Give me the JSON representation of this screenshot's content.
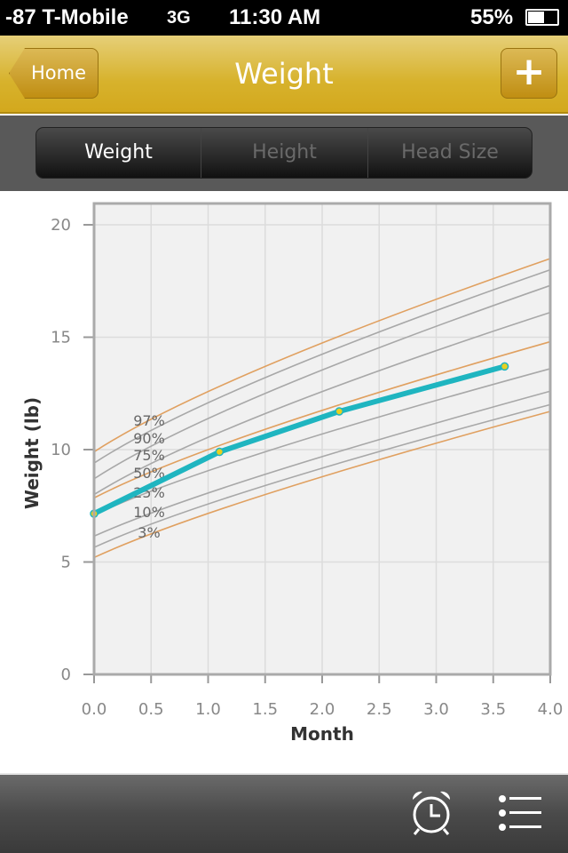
{
  "status_bar": {
    "signal": "-87 T-Mobile",
    "network": "3G",
    "time": "11:30 AM",
    "battery": "55%",
    "battery_level": 0.55
  },
  "nav": {
    "back_label": "Home",
    "title": "Weight",
    "add_label": "+"
  },
  "segments": [
    {
      "label": "Weight",
      "selected": true
    },
    {
      "label": "Height",
      "selected": false
    },
    {
      "label": "Head Size",
      "selected": false
    }
  ],
  "toolbar": {
    "icons": [
      "alarm-clock-icon",
      "list-icon"
    ]
  },
  "chart_data": {
    "type": "line",
    "xlabel": "Month",
    "ylabel": "Weight (lb)",
    "xlim": [
      0,
      4
    ],
    "ylim": [
      0,
      20
    ],
    "xticks": [
      "0.0",
      "0.5",
      "1.0",
      "1.5",
      "2.0",
      "2.5",
      "3.0",
      "3.5",
      "4.0"
    ],
    "yticks": [
      "0",
      "5",
      "10",
      "15",
      "20"
    ],
    "grid": true,
    "percentile_labels": [
      "97%",
      "90%",
      "75%",
      "50%",
      "25%",
      "10%",
      "3%"
    ],
    "percentile_curves": [
      {
        "color": "#e0a060",
        "x": [
          0,
          1.5,
          4
        ],
        "y": [
          9.9,
          13.7,
          18.5
        ]
      },
      {
        "color": "#a8a8a8",
        "x": [
          0,
          1.5,
          4
        ],
        "y": [
          9.4,
          13.2,
          18.0
        ]
      },
      {
        "color": "#a8a8a8",
        "x": [
          0,
          1.5,
          4
        ],
        "y": [
          8.7,
          12.5,
          17.3
        ]
      },
      {
        "color": "#a8a8a8",
        "x": [
          0,
          1.5,
          4
        ],
        "y": [
          8.0,
          11.6,
          16.1
        ]
      },
      {
        "color": "#e0a060",
        "x": [
          0,
          1.5,
          4
        ],
        "y": [
          7.85,
          10.9,
          14.8
        ]
      },
      {
        "color": "#a8a8a8",
        "x": [
          0,
          1.5,
          4
        ],
        "y": [
          7.1,
          9.9,
          13.6
        ]
      },
      {
        "color": "#a8a8a8",
        "x": [
          0,
          1.5,
          4
        ],
        "y": [
          6.15,
          8.9,
          12.6
        ]
      },
      {
        "color": "#a8a8a8",
        "x": [
          0,
          1.5,
          4
        ],
        "y": [
          5.65,
          8.4,
          12.0
        ]
      },
      {
        "color": "#e0a060",
        "x": [
          0,
          1.5,
          4
        ],
        "y": [
          5.2,
          8.0,
          11.7
        ]
      }
    ],
    "series": [
      {
        "color": "#1fb5c0",
        "marker_color": "#e8d020",
        "x": [
          0,
          1.1,
          2.15,
          3.6
        ],
        "y": [
          7.15,
          9.9,
          11.7,
          13.7
        ]
      }
    ]
  }
}
